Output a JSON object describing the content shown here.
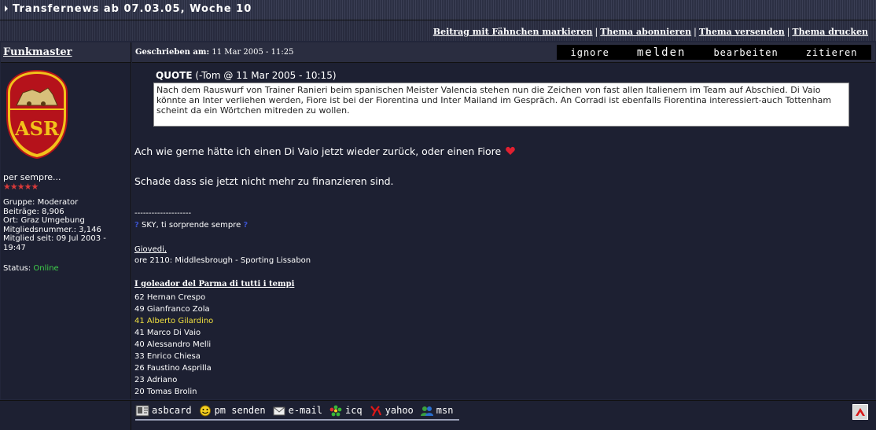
{
  "thread": {
    "title": "Transfernews ab 07.03.05, Woche 10"
  },
  "actions": {
    "mark": "Beitrag mit Fähnchen markieren",
    "subscribe": "Thema abonnieren",
    "send": "Thema versenden",
    "print": "Thema drucken",
    "separator": "|"
  },
  "author": {
    "name": "Funkmaster",
    "motto": "per sempre...",
    "stars": "★★★★★",
    "group": "Gruppe: Moderator",
    "posts": "Beiträge: 8,906",
    "location": "Ort: Graz Umgebung",
    "member_no": "Mitgliedsnummer.: 3,146",
    "member_since": "Mitglied seit: 09 Jul 2003 - 19:47",
    "status_label": "Status: ",
    "status_value": "Online"
  },
  "post": {
    "written_label": "Geschrieben am:",
    "written_date": " 11 Mar 2005 - 11:25",
    "buttons": {
      "ignore": "ignore",
      "report": "melden",
      "edit": "bearbeiten",
      "quote": "zitieren"
    },
    "quote_label": "QUOTE",
    "quote_meta": " (-Tom @ 11 Mar 2005 - 10:15)",
    "quote_text": "Nach dem Rauswurf von Trainer Ranieri beim spanischen Meister Valencia stehen nun die Zeichen von fast allen Italienern im Team auf Abschied. Di Vaio könnte an Inter verliehen werden, Fiore ist bei der Fiorentina und Inter Mailand im Gespräch. An Corradi ist ebenfalls Fiorentina interessiert-auch Tottenham scheint da ein Wörtchen mitreden zu wollen.",
    "para1": "Ach wie gerne hätte ich einen Di Vaio jetzt wieder zurück, oder einen Fiore",
    "para2": "Schade dass sie jetzt nicht mehr zu finanzieren sind."
  },
  "signature": {
    "line": "--------------------",
    "sky_q1": "?",
    "sky": " SKY, ti sorprende sempre ",
    "sky_q2": "?",
    "giovedi": "Giovedi,",
    "ore": "ore 2110: Middlesbrough - Sporting Lissabon",
    "scorers_title": "I goleador del Parma di tutti i tempi",
    "scorers": [
      "62 Hernan Crespo",
      "49 Gianfranco Zola",
      "41 Alberto Gilardino",
      "41 Marco Di Vaio",
      "40 Alessandro Melli",
      "33 Enrico Chiesa",
      "26 Faustino Asprilla",
      "23 Adriano",
      "20 Tomas Brolin"
    ]
  },
  "contacts": {
    "asbcard": "asbcard",
    "pm": "pm senden",
    "email": "e-mail",
    "icq": "icq",
    "yahoo": "yahoo",
    "msn": "msn"
  },
  "colors": {
    "online": "#3fcf4a",
    "highlight": "#f0e040",
    "stars": "#d83a3a"
  },
  "icons": [
    "asbcard-icon",
    "smiley-icon",
    "mail-icon",
    "icq-flower-icon",
    "yahoo-icon",
    "msn-icon",
    "heart-icon",
    "roma-logo",
    "top-arrow-icon"
  ]
}
